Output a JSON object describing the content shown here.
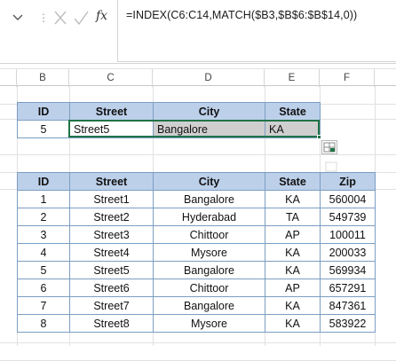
{
  "formula_bar": {
    "fx_label": "fx",
    "formula": "=INDEX(C6:C14,MATCH($B3,$B$6:$B$14,0))"
  },
  "columns": [
    "B",
    "C",
    "D",
    "E",
    "F"
  ],
  "lookup_table": {
    "headers": [
      "ID",
      "Street",
      "City",
      "State"
    ],
    "row": [
      "5",
      "Street5",
      "Bangalore",
      "KA"
    ]
  },
  "data_table": {
    "headers": [
      "ID",
      "Street",
      "City",
      "State",
      "Zip"
    ],
    "rows": [
      [
        "1",
        "Street1",
        "Bangalore",
        "KA",
        "560004"
      ],
      [
        "2",
        "Street2",
        "Hyderabad",
        "TA",
        "549739"
      ],
      [
        "3",
        "Street3",
        "Chittoor",
        "AP",
        "100011"
      ],
      [
        "4",
        "Street4",
        "Mysore",
        "KA",
        "200033"
      ],
      [
        "5",
        "Street5",
        "Bangalore",
        "KA",
        "569934"
      ],
      [
        "6",
        "Street6",
        "Chittoor",
        "AP",
        "657291"
      ],
      [
        "7",
        "Street7",
        "Bangalore",
        "KA",
        "847361"
      ],
      [
        "8",
        "Street8",
        "Mysore",
        "KA",
        "583922"
      ]
    ]
  },
  "colors": {
    "header_fill": "#bdd0ea",
    "border": "#7b9ec2",
    "selection": "#217346",
    "selected_fill": "#cfcfcf"
  }
}
